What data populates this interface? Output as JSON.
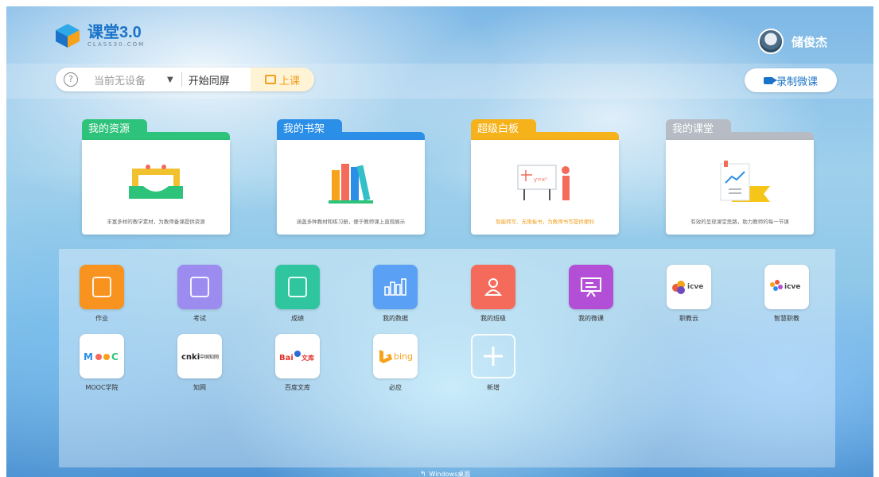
{
  "app": {
    "logo_title": "课堂3.0",
    "logo_sub": "CLASS30.COM"
  },
  "user": {
    "name": "储俊杰",
    "avatar_icon": "user-avatar-icon"
  },
  "toolbar": {
    "device_placeholder": "当前无设备",
    "sync_label": "开始同屏",
    "start_class_label": "上课",
    "record_label": "录制微课",
    "accent": "#1a73c8"
  },
  "cards": [
    {
      "title": "我的资源",
      "desc": "丰富多样的教学素材，为教师备课提供资源",
      "color": "#2ec37a"
    },
    {
      "title": "我的书架",
      "desc": "涵盖多种教材和练习册，便于教师课上直观展示",
      "color": "#2b8fe8"
    },
    {
      "title": "超级白板",
      "desc": "智能转写、无限板书，为教师书写提供便利",
      "color": "#f5b21a"
    },
    {
      "title": "我的课堂",
      "desc": "有效的呈现课堂思路，助力教师的每一节课",
      "color": "#b7bcc4"
    }
  ],
  "apps": [
    {
      "label": "作业",
      "icon": "homework-icon",
      "color": "#f7931e"
    },
    {
      "label": "考试",
      "icon": "exam-icon",
      "color": "#9d8cf0"
    },
    {
      "label": "成绩",
      "icon": "grades-icon",
      "color": "#2fc59f"
    },
    {
      "label": "我的数据",
      "icon": "data-chart-icon",
      "color": "#5aa0f5"
    },
    {
      "label": "我的班级",
      "icon": "class-person-icon",
      "color": "#f56b5b"
    },
    {
      "label": "我的微课",
      "icon": "micro-lesson-icon",
      "color": "#b34fd6"
    },
    {
      "label": "职教云",
      "icon": "icve-cloud-icon",
      "color": "#ffffff",
      "logo_text": "icve"
    },
    {
      "label": "智慧职教",
      "icon": "icve-smart-icon",
      "color": "#ffffff",
      "logo_text": "icve"
    },
    {
      "label": "MOOC学院",
      "icon": "mooc-logo-icon",
      "color": "#ffffff",
      "logo_text": "MOOC"
    },
    {
      "label": "知网",
      "icon": "cnki-logo-icon",
      "color": "#ffffff",
      "logo_text": "CNKI中国知网"
    },
    {
      "label": "百度文库",
      "icon": "baidu-wenku-logo-icon",
      "color": "#ffffff",
      "logo_text": "Bai文库"
    },
    {
      "label": "必应",
      "icon": "bing-logo-icon",
      "color": "#ffffff",
      "logo_text": "bing"
    },
    {
      "label": "新增",
      "icon": "add-plus-icon",
      "color": "transparent"
    }
  ],
  "footer": {
    "windows_desktop": "Windows桌面"
  }
}
